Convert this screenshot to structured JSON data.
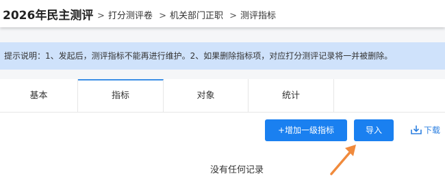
{
  "header": {
    "title": "2026年民主测评",
    "breadcrumbs": [
      {
        "label": "打分测评卷",
        "sep": ">"
      },
      {
        "label": "机关部门正职",
        "sep": ">"
      },
      {
        "label": "测评指标",
        "sep": ">"
      }
    ]
  },
  "notice": {
    "text": "提示说明：1、发起后，测评指标不能再进行维护。2、如果删除指标项，对应打分测评记录将一并被删除。"
  },
  "tabs": [
    {
      "label": "基本"
    },
    {
      "label": "指标"
    },
    {
      "label": "对象"
    },
    {
      "label": "统计"
    }
  ],
  "active_tab": "指标",
  "toolbar": {
    "add_label": "+增加一级指标",
    "import_label": "导入",
    "download_label": "下载"
  },
  "empty_text": "没有任何记录",
  "colors": {
    "primary": "#1a80f0",
    "notice_bg": "#cfe2fb",
    "annotation_arrow": "#f08a3c"
  }
}
